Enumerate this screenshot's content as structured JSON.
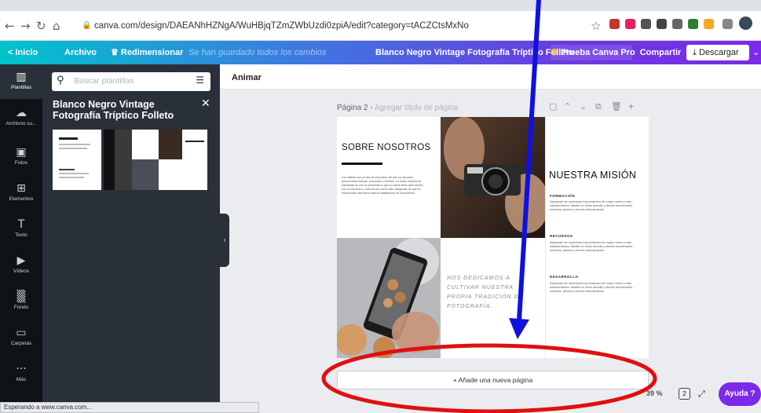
{
  "browser": {
    "url": "canva.com/design/DAEANhHZNgA/WuHBjqTZmZWbUzdi0zpiA/edit?category=tACZCtsMxNo",
    "status_text": "Esperando a www.canva.com..."
  },
  "topbar": {
    "home_label": "Inicio",
    "file_label": "Archivo",
    "resize_label": "Redimensionar",
    "saved_text": "Se han guardado todos los cambios",
    "doc_title": "Blanco Negro Vintage Fotografía Tríptico Folleto",
    "try_pro_label": "Prueba Canva Pro",
    "share_label": "Compartir",
    "download_label": "Descargar"
  },
  "rail": {
    "items": [
      {
        "label": "Plantillas",
        "icon": "template-icon"
      },
      {
        "label": "Archivos su...",
        "icon": "upload-icon"
      },
      {
        "label": "Fotos",
        "icon": "photo-icon"
      },
      {
        "label": "Elementos",
        "icon": "elements-icon"
      },
      {
        "label": "Texto",
        "icon": "text-icon"
      },
      {
        "label": "Vídeos",
        "icon": "video-icon"
      },
      {
        "label": "Fondo",
        "icon": "background-icon"
      },
      {
        "label": "Carpetas",
        "icon": "folder-icon"
      },
      {
        "label": "Más",
        "icon": "more-icon"
      }
    ]
  },
  "panel": {
    "search_placeholder": "Buscar plantillas",
    "title": "Blanco Negro Vintage Fotografía Tríptico Folleto"
  },
  "canvas": {
    "toolbar_animate": "Animar",
    "page_label": "Página 2 -",
    "page_title_hint": "Agregar título de página",
    "add_page_label": "+ Añade una nueva página",
    "zoom_text": "39 %",
    "page_count": "2",
    "help_label": "Ayuda ?"
  },
  "brochure": {
    "about_title": "SOBRE NOSOTROS",
    "about_body": "Los folletos son un tipo de impresión útil que se usa para promocionar marcas, productos y eventos. La mejor manera de maximizar su uso es presentar lo que tu marca tiene para ofrecer con un resumen y una sección corta más. Asegúrate de que su introducción sea breve para la satisfacción de sus lectores.",
    "quote": "NOS DEDICAMOS A CULTIVAR NUESTRA PROPIA TRADICIÓN DE FOTOGRAFÍA.",
    "mission_title": "NUESTRA MISIÓN",
    "sections": [
      {
        "heading": "FORMACIÓN",
        "body": "Asegúrate de mencionar tus productos de mayor venta o más característicos. Mantén un texto sencillo y directo enumerando nombres, precios y breves descripciones."
      },
      {
        "heading": "RECURSOS",
        "body": "Asegúrate de mencionar tus productos de mayor venta o más característicos. Mantén un texto sencillo y directo enumerando nombres, precios y breves descripciones."
      },
      {
        "heading": "DESARROLLO",
        "body": "Asegúrate de mencionar tus productos de mayor venta o más característicos. Mantén un texto sencillo y directo enumerando nombres, precios y breves descripciones."
      }
    ]
  },
  "colors": {
    "accent_purple": "#7d2ae8",
    "annotation_arrow": "#1010e0",
    "annotation_ellipse": "#e01010"
  }
}
